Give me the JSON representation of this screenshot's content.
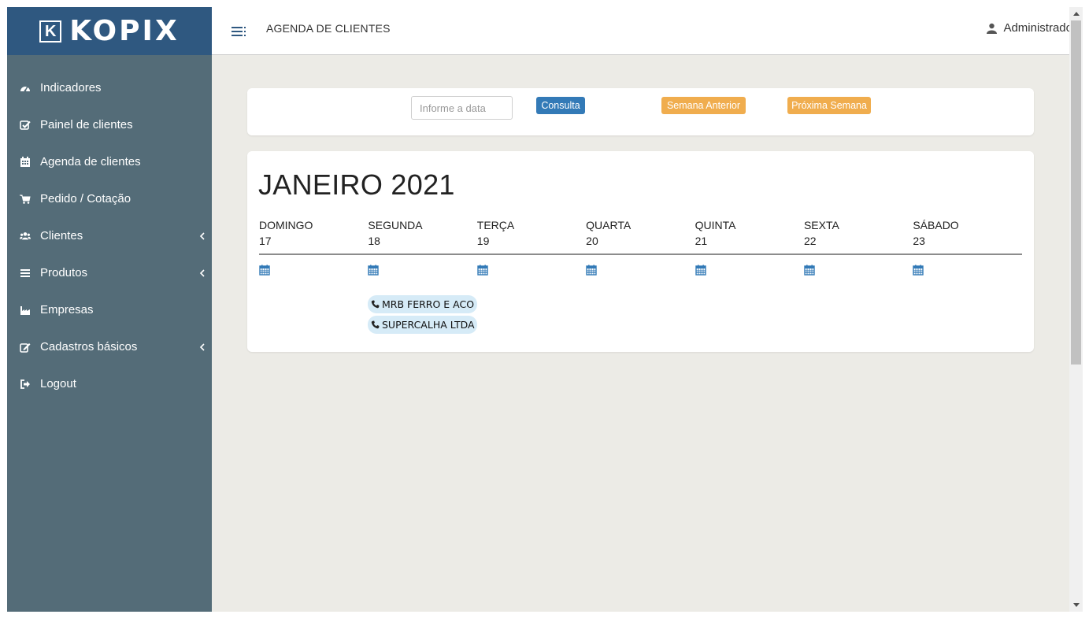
{
  "brand": {
    "logo_letter": "K",
    "name": "KOPIX",
    "colors": {
      "header": "#2f5880",
      "sidebar": "#546c78"
    }
  },
  "sidebar": {
    "items": [
      {
        "label": "Indicadores",
        "icon": "dashboard-icon",
        "has_submenu": false
      },
      {
        "label": "Painel de clientes",
        "icon": "check-square-icon",
        "has_submenu": false
      },
      {
        "label": "Agenda de clientes",
        "icon": "calendar-icon",
        "has_submenu": false
      },
      {
        "label": "Pedido / Cotação",
        "icon": "cart-icon",
        "has_submenu": false
      },
      {
        "label": "Clientes",
        "icon": "users-icon",
        "has_submenu": true
      },
      {
        "label": "Produtos",
        "icon": "list-icon",
        "has_submenu": true
      },
      {
        "label": "Empresas",
        "icon": "industry-icon",
        "has_submenu": false
      },
      {
        "label": "Cadastros básicos",
        "icon": "edit-icon",
        "has_submenu": true
      },
      {
        "label": "Logout",
        "icon": "sign-out-icon",
        "has_submenu": false
      }
    ]
  },
  "header": {
    "title": "AGENDA DE CLIENTES",
    "user": "Administrador"
  },
  "search": {
    "date_placeholder": "Informe a data",
    "consulta_label": "Consulta",
    "prev_week_label": "Semana Anterior",
    "next_week_label": "Próxima Semana",
    "colors": {
      "primary": "#337ab7",
      "warning": "#f0ad4e"
    }
  },
  "calendar": {
    "month_title": "JANEIRO 2021",
    "days": [
      {
        "name": "DOMINGO",
        "number": "17"
      },
      {
        "name": "SEGUNDA",
        "number": "18"
      },
      {
        "name": "TERÇA",
        "number": "19"
      },
      {
        "name": "QUARTA",
        "number": "20"
      },
      {
        "name": "QUINTA",
        "number": "21"
      },
      {
        "name": "SEXTA",
        "number": "22"
      },
      {
        "name": "SÁBADO",
        "number": "23"
      }
    ],
    "events": [
      {
        "day": "SEGUNDA",
        "label": "MRB FERRO E ACO L",
        "icon": "phone-icon"
      },
      {
        "day": "SEGUNDA",
        "label": "SUPERCALHA LTDA",
        "icon": "phone-icon"
      }
    ]
  }
}
